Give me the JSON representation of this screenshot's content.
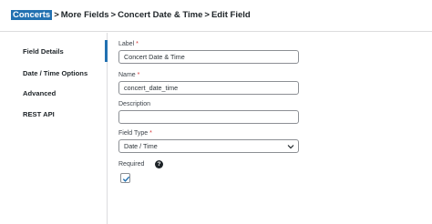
{
  "breadcrumb": {
    "items": [
      "Concerts",
      "More Fields",
      "Concert Date & Time",
      "Edit Field"
    ],
    "separator": ">"
  },
  "sidebar": {
    "items": [
      {
        "label": "Field Details",
        "active": true
      },
      {
        "label": "Date / Time Options",
        "active": false
      },
      {
        "label": "Advanced",
        "active": false
      },
      {
        "label": "REST API",
        "active": false
      }
    ]
  },
  "form": {
    "label": {
      "label": "Label",
      "required_mark": "*",
      "value": "Concert Date & Time"
    },
    "name": {
      "label": "Name",
      "required_mark": "*",
      "value": "concert_date_time"
    },
    "description": {
      "label": "Description",
      "value": ""
    },
    "field_type": {
      "label": "Field Type",
      "required_mark": "*",
      "selected": "Date / Time"
    },
    "required": {
      "label": "Required",
      "help_icon": "question-circle-icon",
      "checked": true
    }
  },
  "colors": {
    "accent": "#2271b1",
    "required": "#d63638",
    "text": "#1d2327"
  }
}
